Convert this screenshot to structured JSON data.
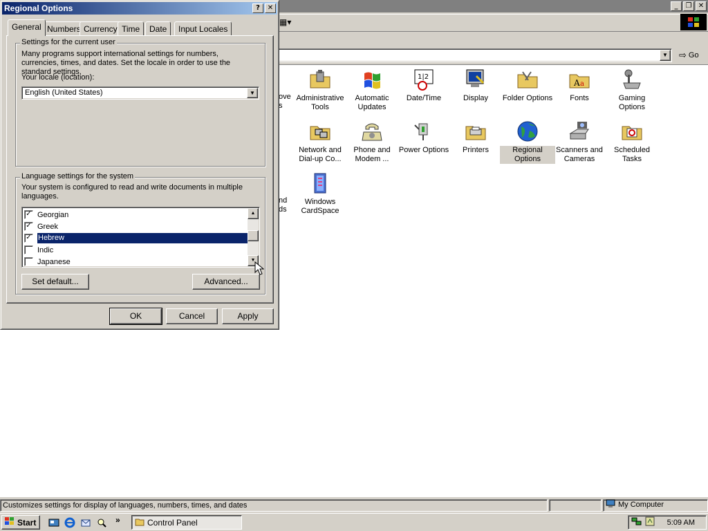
{
  "explorer": {
    "go_label": "Go",
    "items": [
      {
        "name": "adm-tools",
        "label": "Administrative Tools",
        "icon": "folder-tools-icon"
      },
      {
        "name": "auto-updates",
        "label": "Automatic Updates",
        "icon": "windows-flag-icon"
      },
      {
        "name": "date-time",
        "label": "Date/Time",
        "icon": "calendar-clock-icon"
      },
      {
        "name": "display",
        "label": "Display",
        "icon": "monitor-icon"
      },
      {
        "name": "folder-options",
        "label": "Folder Options",
        "icon": "folder-icon"
      },
      {
        "name": "fonts",
        "label": "Fonts",
        "icon": "fonts-folder-icon"
      },
      {
        "name": "gaming-options",
        "label": "Gaming Options",
        "icon": "joystick-icon"
      },
      {
        "name": "network",
        "label": "Network and Dial-up Co...",
        "icon": "network-folder-icon"
      },
      {
        "name": "phone-modem",
        "label": "Phone and Modem ...",
        "icon": "phone-icon"
      },
      {
        "name": "power-options",
        "label": "Power Options",
        "icon": "plug-icon"
      },
      {
        "name": "printers",
        "label": "Printers",
        "icon": "printer-folder-icon"
      },
      {
        "name": "regional-options",
        "label": "Regional Options",
        "icon": "globe-icon"
      },
      {
        "name": "scanners",
        "label": "Scanners and Cameras",
        "icon": "scanner-icon"
      },
      {
        "name": "scheduled-tasks",
        "label": "Scheduled Tasks",
        "icon": "task-folder-icon"
      },
      {
        "name": "cardspace",
        "label": "Windows CardSpace",
        "icon": "cardspace-icon"
      }
    ],
    "partial_left_1": "ove\ns",
    "partial_left_2": "nd\nds",
    "status_text": "Customizes settings for display of languages, numbers, times, and dates",
    "status_zone": "My Computer"
  },
  "taskbar": {
    "start_label": "Start",
    "more_label": "»",
    "task_label": "Control Panel",
    "clock": "5:09 AM"
  },
  "dialog": {
    "title": "Regional Options",
    "help_label": "?",
    "close_label": "✕",
    "tabs": [
      "General",
      "Numbers",
      "Currency",
      "Time",
      "Date",
      "Input Locales"
    ],
    "user_group_title": "Settings for the current user",
    "user_group_text": "Many programs support international settings for numbers, currencies, times, and dates. Set the locale in order to use the standard settings.",
    "locale_label": "Your locale (location):",
    "locale_value": "English (United States)",
    "system_group_title": "Language settings for the system",
    "system_group_text": "Your system is configured to read and write documents in multiple languages.",
    "languages": [
      {
        "name": "Georgian",
        "checked": true
      },
      {
        "name": "Greek",
        "checked": true
      },
      {
        "name": "Hebrew",
        "checked": true,
        "selected": true
      },
      {
        "name": "Indic",
        "checked": false
      },
      {
        "name": "Japanese",
        "checked": false
      }
    ],
    "set_default_label": "Set default...",
    "advanced_label": "Advanced...",
    "ok_label": "OK",
    "cancel_label": "Cancel",
    "apply_label": "Apply"
  },
  "colors": {
    "title_active": "#0a246a",
    "title_inactive": "#808080",
    "face": "#d4d0c8",
    "selection": "#0a246a"
  }
}
